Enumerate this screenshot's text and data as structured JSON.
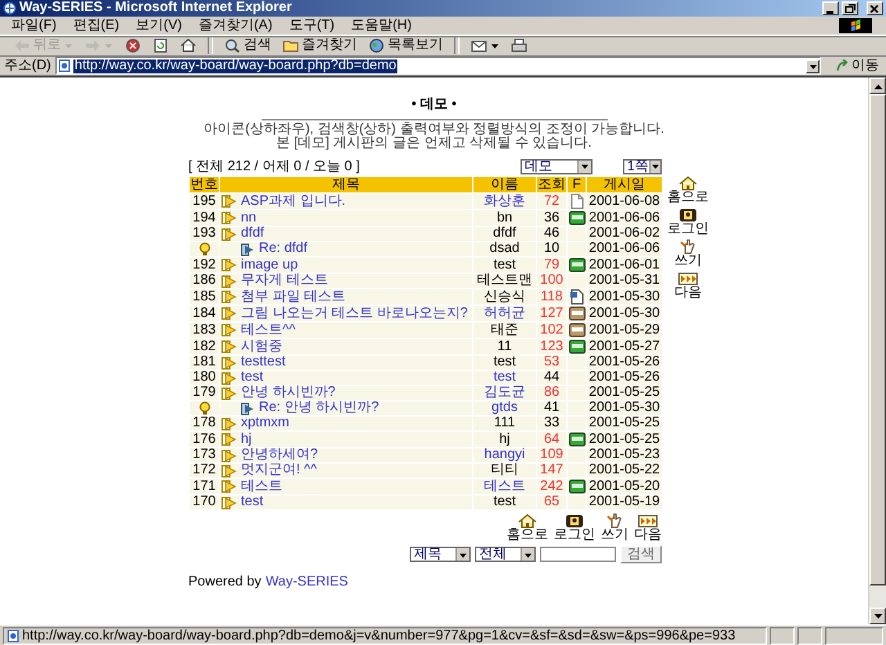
{
  "window": {
    "title": "Way-SERIES - Microsoft Internet Explorer"
  },
  "menu": [
    "파일(F)",
    "편집(E)",
    "보기(V)",
    "즐겨찾기(A)",
    "도구(T)",
    "도움말(H)"
  ],
  "toolbar": [
    {
      "kind": "back",
      "label": "뒤로",
      "disabled": true
    },
    {
      "kind": "forward",
      "disabled": true
    },
    {
      "kind": "stop",
      "disabled": false
    },
    {
      "kind": "refresh",
      "disabled": false
    },
    {
      "kind": "home",
      "disabled": false
    },
    {
      "kind": "search",
      "label": "검색",
      "disabled": false
    },
    {
      "kind": "favorites",
      "label": "즐겨찾기",
      "disabled": false
    },
    {
      "kind": "history",
      "label": "목록보기",
      "disabled": false
    },
    {
      "kind": "mail",
      "disabled": false
    },
    {
      "kind": "print",
      "disabled": false
    }
  ],
  "address": {
    "label": "주소(D)",
    "url": "http://way.co.kr/way-board/way-board.php?db=demo",
    "selected": true,
    "go": "이동"
  },
  "board": {
    "title": "• 데모 •",
    "description": [
      "아이콘(상하좌우), 검색창(상하) 출력여부와 정렬방식의 조정이 가능합니다.",
      "본 [데모] 게시판의 글은 언제고 삭제될 수 있습니다."
    ],
    "stats": "[ 전체 212 / 어제 0 / 오늘 0 ]",
    "board_select": "데모",
    "page_select": "1쪽",
    "columns": [
      "번호",
      "제목",
      "이름",
      "조회",
      "F",
      "게시일"
    ],
    "rows": [
      {
        "kind": "post",
        "number": "195",
        "title": "ASP과제 입니다.",
        "author": "화상훈",
        "author_link": true,
        "hits": "72",
        "hot": true,
        "attachment": {
          "kind": "file"
        },
        "date": "2001-06-08"
      },
      {
        "kind": "post",
        "number": "194",
        "title": "nn",
        "author": "bn",
        "author_link": false,
        "hits": "36",
        "hot": false,
        "attachment": {
          "kind": "image"
        },
        "date": "2001-06-06"
      },
      {
        "kind": "post",
        "number": "193",
        "title": "dfdf",
        "author": "dfdf",
        "author_link": false,
        "hits": "46",
        "hot": false,
        "date": "2001-06-02"
      },
      {
        "kind": "reply",
        "title": "Re: dfdf",
        "author": "dsad",
        "author_link": false,
        "hits": "10",
        "hot": false,
        "date": "2001-06-06"
      },
      {
        "kind": "post",
        "number": "192",
        "title": "image up",
        "author": "test",
        "author_link": false,
        "hits": "79",
        "hot": true,
        "attachment": {
          "kind": "image"
        },
        "date": "2001-06-01"
      },
      {
        "kind": "post",
        "number": "186",
        "title": "무자게 테스트",
        "author": "테스트맨",
        "author_link": false,
        "hits": "100",
        "hot": true,
        "date": "2001-05-31"
      },
      {
        "kind": "post",
        "number": "185",
        "title": "첨부 파일 테스트",
        "author": "신승식",
        "author_link": false,
        "hits": "118",
        "hot": true,
        "attachment": {
          "kind": "doc"
        },
        "date": "2001-05-30"
      },
      {
        "kind": "post",
        "number": "184",
        "title": "그림 나오는거 테스트 바로나오는지?",
        "author": "허허균",
        "author_link": true,
        "hits": "127",
        "hot": true,
        "attachment": {
          "kind": "archive"
        },
        "date": "2001-05-30"
      },
      {
        "kind": "post",
        "number": "183",
        "title": "테스트^^",
        "author": "태준",
        "author_link": false,
        "hits": "102",
        "hot": true,
        "attachment": {
          "kind": "archive"
        },
        "date": "2001-05-29"
      },
      {
        "kind": "post",
        "number": "182",
        "title": "시험중",
        "author": "11",
        "author_link": false,
        "hits": "123",
        "hot": true,
        "attachment": {
          "kind": "image"
        },
        "date": "2001-05-27"
      },
      {
        "kind": "post",
        "number": "181",
        "title": "testtest",
        "author": "test",
        "author_link": false,
        "hits": "53",
        "hot": true,
        "date": "2001-05-26"
      },
      {
        "kind": "post",
        "number": "180",
        "title": "test",
        "author": "test",
        "author_link": true,
        "hits": "44",
        "hot": false,
        "date": "2001-05-26"
      },
      {
        "kind": "post",
        "number": "179",
        "title": "안녕 하시빈까?",
        "author": "김도균",
        "author_link": true,
        "hits": "86",
        "hot": true,
        "date": "2001-05-25"
      },
      {
        "kind": "reply",
        "title": "Re: 안녕 하시빈까?",
        "author": "gtds",
        "author_link": true,
        "hits": "41",
        "hot": false,
        "date": "2001-05-30"
      },
      {
        "kind": "post",
        "number": "178",
        "title": "xptmxm",
        "author": "111",
        "author_link": false,
        "hits": "33",
        "hot": false,
        "date": "2001-05-25"
      },
      {
        "kind": "post",
        "number": "176",
        "title": "hj",
        "author": "hj",
        "author_link": false,
        "hits": "64",
        "hot": true,
        "attachment": {
          "kind": "image"
        },
        "date": "2001-05-25"
      },
      {
        "kind": "post",
        "number": "173",
        "title": "안녕하세여?",
        "author": "hangyi",
        "author_link": true,
        "hits": "109",
        "hot": true,
        "date": "2001-05-23"
      },
      {
        "kind": "post",
        "number": "172",
        "title": "멋지군여! ^^",
        "author": "티티",
        "author_link": false,
        "hits": "147",
        "hot": true,
        "date": "2001-05-22"
      },
      {
        "kind": "post",
        "number": "171",
        "title": "테스트",
        "author": "테스트",
        "author_link": true,
        "hits": "242",
        "hot": true,
        "attachment": {
          "kind": "image"
        },
        "date": "2001-05-20"
      },
      {
        "kind": "post",
        "number": "170",
        "title": "test",
        "author": "test",
        "author_link": false,
        "hits": "65",
        "hot": true,
        "date": "2001-05-19"
      }
    ],
    "side_nav": [
      {
        "kind": "home",
        "label": "홈으로"
      },
      {
        "kind": "login",
        "label": "로그인"
      },
      {
        "kind": "write",
        "label": "쓰기"
      },
      {
        "kind": "next",
        "label": "다음"
      }
    ],
    "bottom_nav": [
      {
        "kind": "home",
        "label": "홈으로"
      },
      {
        "kind": "login",
        "label": "로그인"
      },
      {
        "kind": "write",
        "label": "쓰기"
      },
      {
        "kind": "next",
        "label": "다음"
      }
    ],
    "search": {
      "field_select": "제목",
      "scope_select": "전체",
      "button": "검색"
    },
    "footer": {
      "text": "Powered by",
      "link": "Way-SERIES"
    }
  },
  "status_bar": {
    "text": "http://way.co.kr/way-board/way-board.php?db=demo&j=v&number=977&pg=1&cv=&sf=&sd=&sw=&ps=996&pe=933"
  }
}
